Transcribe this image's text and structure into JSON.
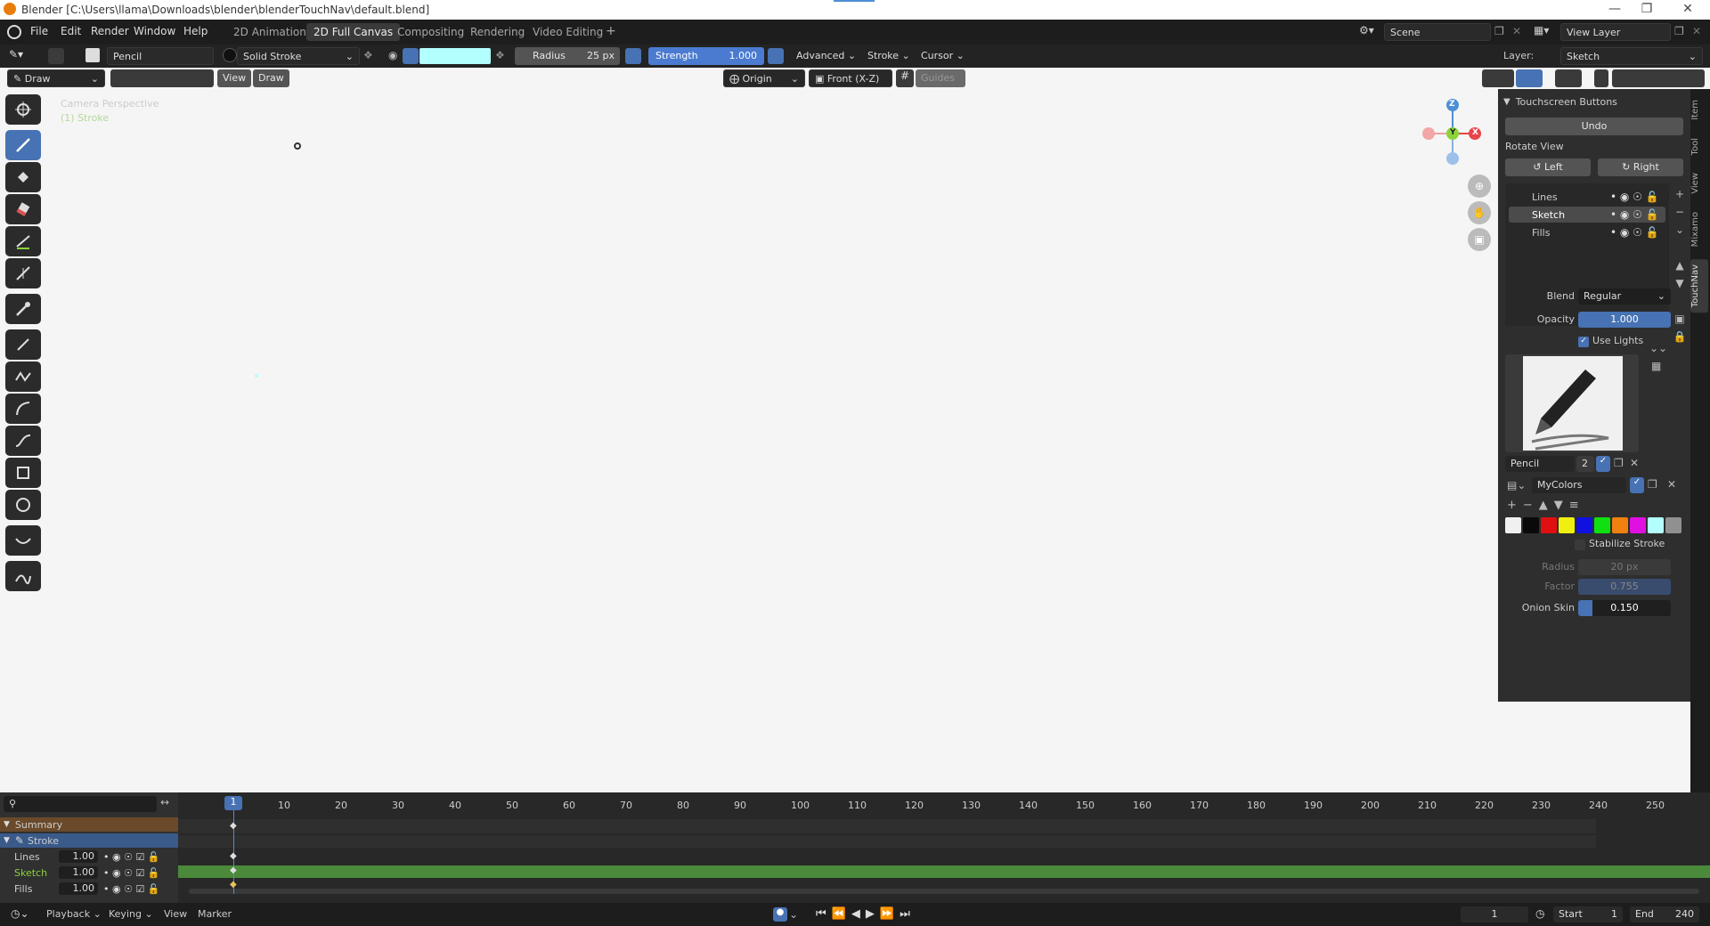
{
  "window": {
    "title": "Blender [C:\\Users\\llama\\Downloads\\blender\\blenderTouchNav\\default.blend]"
  },
  "menu": {
    "items": [
      "File",
      "Edit",
      "Render",
      "Window",
      "Help"
    ]
  },
  "workspaces": {
    "tabs": [
      "2D Animation",
      "2D Full Canvas",
      "Compositing",
      "Rendering",
      "Video Editing"
    ],
    "active": "2D Full Canvas",
    "add": "+"
  },
  "scene": {
    "label": "Scene",
    "view_layer": "View Layer"
  },
  "toolheader": {
    "brush": "Pencil",
    "stroke_type": "Solid Stroke",
    "radius_label": "Radius",
    "radius_value": "25 px",
    "strength_label": "Strength",
    "strength_value": "1.000",
    "advanced": "Advanced",
    "stroke": "Stroke",
    "cursor": "Cursor",
    "layer_label": "Layer:",
    "layer_value": "Sketch",
    "color_swatch": "#b3ffff"
  },
  "viewheader": {
    "mode": "Draw",
    "view": "View",
    "draw": "Draw",
    "origin": "Origin",
    "plane": "Front (X-Z)",
    "guides": "Guides"
  },
  "viewport": {
    "overlay_title": "Camera Perspective",
    "overlay_sub": "(1) Stroke",
    "gizmo": {
      "z": "Z",
      "y": "Y",
      "x": "X"
    }
  },
  "npanel": {
    "title": "Touchscreen Buttons",
    "undo": "Undo",
    "rotate_view": "Rotate View",
    "left": "Left",
    "right": "Right",
    "layers": [
      {
        "name": "Lines"
      },
      {
        "name": "Sketch",
        "active": true
      },
      {
        "name": "Fills"
      }
    ],
    "blend_label": "Blend",
    "blend_value": "Regular",
    "opacity_label": "Opacity",
    "opacity_value": "1.000",
    "opacity_fraction": 1.0,
    "use_lights": "Use Lights",
    "brush_name": "Pencil",
    "brush_users": "2",
    "palette_name": "MyColors",
    "palette": [
      "#f0f0f0",
      "#0a0a0a",
      "#e01010",
      "#f0f010",
      "#1010e0",
      "#10e010",
      "#f08010",
      "#e010e0",
      "#b3ffff",
      "#909090"
    ],
    "stabilize": "Stabilize Stroke",
    "stab_radius_label": "Radius",
    "stab_radius_value": "20 px",
    "stab_factor_label": "Factor",
    "stab_factor_value": "0.755",
    "onion_label": "Onion Skin",
    "onion_value": "0.150",
    "onion_fraction": 0.15
  },
  "ntabs": [
    "Item",
    "Tool",
    "View",
    "Mixamo",
    "TouchNav"
  ],
  "timeline": {
    "current_frame": "1",
    "ticks": [
      "10",
      "20",
      "30",
      "40",
      "50",
      "60",
      "70",
      "80",
      "90",
      "100",
      "110",
      "120",
      "130",
      "140",
      "150",
      "160",
      "170",
      "180",
      "190",
      "200",
      "210",
      "220",
      "230",
      "240",
      "250"
    ],
    "rows": [
      {
        "name": "Summary"
      },
      {
        "name": "Stroke"
      },
      {
        "name": "Lines",
        "value": "1.00"
      },
      {
        "name": "Sketch",
        "value": "1.00"
      },
      {
        "name": "Fills",
        "value": "1.00"
      }
    ]
  },
  "status": {
    "playback": "Playback",
    "keying": "Keying",
    "view": "View",
    "marker": "Marker",
    "frame": "1",
    "start_label": "Start",
    "start_value": "1",
    "end_label": "End",
    "end_value": "240"
  }
}
